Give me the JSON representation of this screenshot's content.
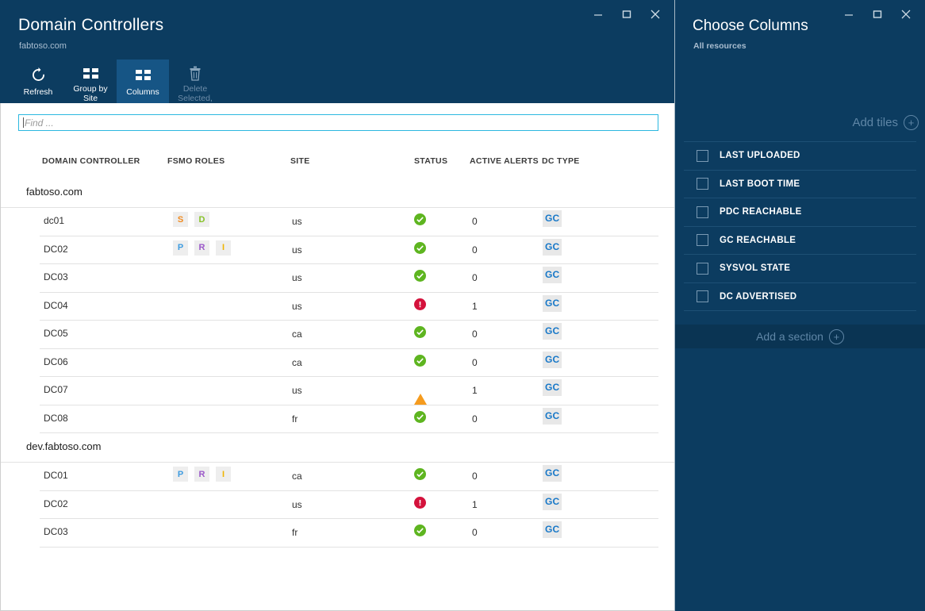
{
  "left_window": {
    "title": "Domain Controllers",
    "subtitle": "fabtoso.com",
    "window_controls": [
      {
        "name": "minimize",
        "glyph": "minimize-icon"
      },
      {
        "name": "maximize",
        "glyph": "maximize-icon"
      },
      {
        "name": "close",
        "glyph": "close-icon"
      }
    ],
    "toolbar": [
      {
        "label": "Refresh",
        "icon": "refresh-icon",
        "state": "normal"
      },
      {
        "label": "Group by\nSite",
        "icon": "grid-icon",
        "state": "normal"
      },
      {
        "label": "Columns",
        "icon": "grid-icon",
        "state": "selected"
      },
      {
        "label": "Delete\nSelected,",
        "icon": "trash-icon",
        "state": "disabled"
      }
    ],
    "search": {
      "value": "",
      "placeholder": "Find ..."
    },
    "table": {
      "columns": [
        "DOMAIN CONTROLLER",
        "FSMO ROLES",
        "SITE",
        "STATUS",
        "ACTIVE ALERTS",
        "DC TYPE"
      ],
      "groups": [
        {
          "name": "fabtoso.com",
          "rows": [
            {
              "domain_controller": "dc01",
              "fsmo_roles": [
                "S",
                "D"
              ],
              "site": "us",
              "status": "ok",
              "active_alerts": "0",
              "dc_type": "GC"
            },
            {
              "domain_controller": "DC02",
              "fsmo_roles": [
                "P",
                "R",
                "I"
              ],
              "site": "us",
              "status": "ok",
              "active_alerts": "0",
              "dc_type": "GC"
            },
            {
              "domain_controller": "DC03",
              "fsmo_roles": [],
              "site": "us",
              "status": "ok",
              "active_alerts": "0",
              "dc_type": "GC"
            },
            {
              "domain_controller": "DC04",
              "fsmo_roles": [],
              "site": "us",
              "status": "error",
              "active_alerts": "1",
              "dc_type": "GC"
            },
            {
              "domain_controller": "DC05",
              "fsmo_roles": [],
              "site": "ca",
              "status": "ok",
              "active_alerts": "0",
              "dc_type": "GC"
            },
            {
              "domain_controller": "DC06",
              "fsmo_roles": [],
              "site": "ca",
              "status": "ok",
              "active_alerts": "0",
              "dc_type": "GC"
            },
            {
              "domain_controller": "DC07",
              "fsmo_roles": [],
              "site": "us",
              "status": "warning",
              "active_alerts": "1",
              "dc_type": "GC"
            },
            {
              "domain_controller": "DC08",
              "fsmo_roles": [],
              "site": "fr",
              "status": "ok",
              "active_alerts": "0",
              "dc_type": "GC"
            }
          ]
        },
        {
          "name": "dev.fabtoso.com",
          "rows": [
            {
              "domain_controller": "DC01",
              "fsmo_roles": [
                "P",
                "R",
                "I"
              ],
              "site": "ca",
              "status": "ok",
              "active_alerts": "0",
              "dc_type": "GC"
            },
            {
              "domain_controller": "DC02",
              "fsmo_roles": [],
              "site": "us",
              "status": "error",
              "active_alerts": "1",
              "dc_type": "GC"
            },
            {
              "domain_controller": "DC03",
              "fsmo_roles": [],
              "site": "fr",
              "status": "ok",
              "active_alerts": "0",
              "dc_type": "GC"
            }
          ]
        }
      ]
    }
  },
  "right_window": {
    "title": "Choose Columns",
    "subtitle": "All resources",
    "window_controls": [
      {
        "name": "minimize",
        "glyph": "minimize-icon"
      },
      {
        "name": "maximize",
        "glyph": "maximize-icon"
      },
      {
        "name": "close",
        "glyph": "close-icon"
      }
    ],
    "add_tiles_label": "Add tiles",
    "add_section_label": "Add a section",
    "columns": [
      {
        "label": "LAST UPLOADED",
        "checked": false
      },
      {
        "label": "LAST BOOT TIME",
        "checked": false
      },
      {
        "label": "PDC REACHABLE",
        "checked": false
      },
      {
        "label": "GC REACHABLE",
        "checked": false
      },
      {
        "label": "SYSVOL STATE",
        "checked": false
      },
      {
        "label": "DC ADVERTISED",
        "checked": false
      }
    ]
  },
  "colors": {
    "chrome_blue": "#0c3c60",
    "selected_tool": "#165585",
    "accent_cyan": "#2bb8e0",
    "status_ok": "#5eb520",
    "status_error": "#d4123c",
    "status_warning": "#f59b1e",
    "gc_blue": "#1878c8",
    "fsmo_S": "#f08a1e",
    "fsmo_D": "#86c226",
    "fsmo_P": "#3f9ce0",
    "fsmo_R": "#9b59c9",
    "fsmo_I": "#f0b400"
  }
}
